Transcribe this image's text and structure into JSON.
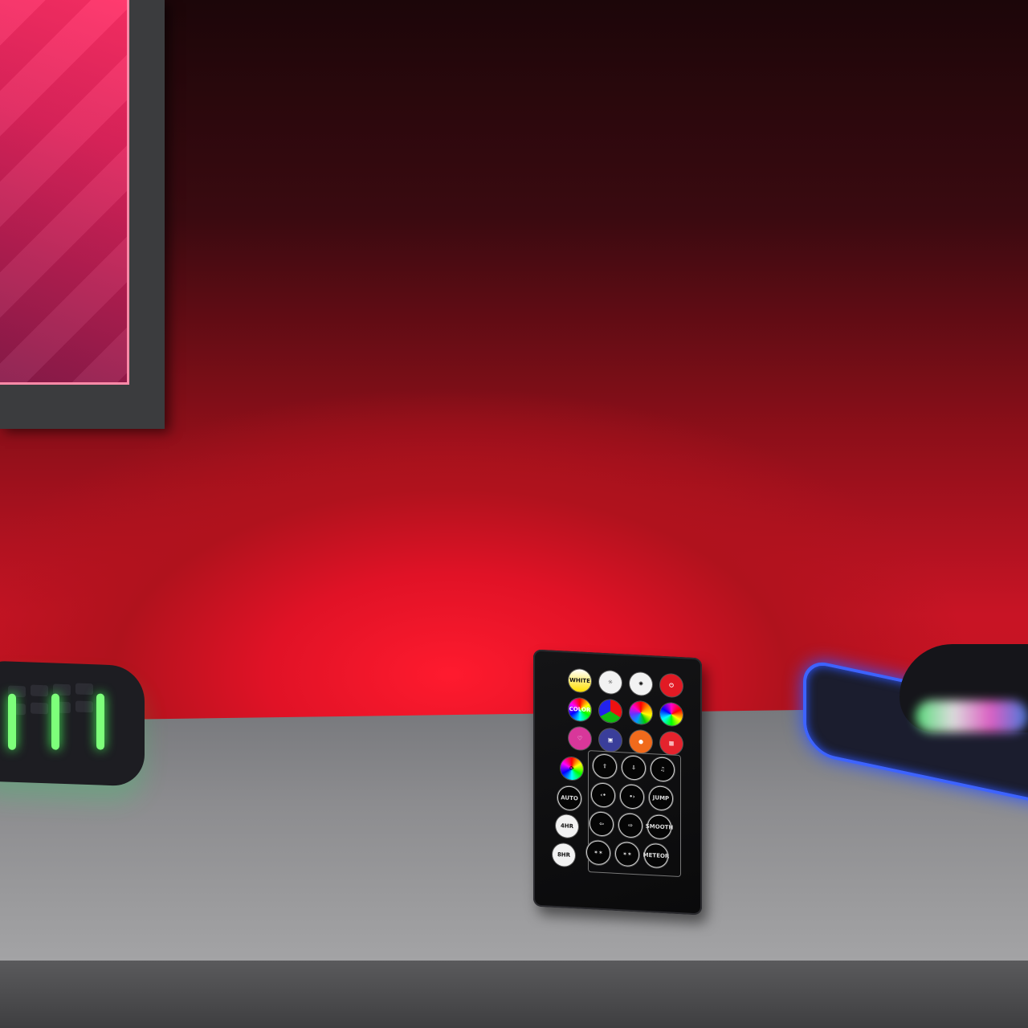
{
  "scene": {
    "colors": {
      "wall_glow": "#e01226",
      "monitor_frame": "#3b3c3e",
      "desk": "#8c8c8f",
      "remote_body": "#0e0e10",
      "keyboard_glow": "#45ff5a",
      "mousepad_glow": "#2d56ff"
    },
    "remote": {
      "top_rows": [
        [
          "WHITE",
          "sun-down-icon",
          "sun-up-icon",
          "power-icon"
        ],
        [
          "COLOR",
          "color-wheel-icon",
          "color-wheel-icon",
          "color-wheel-icon"
        ],
        [
          "heart-icon",
          "cube-icon",
          "pumpkin-icon",
          "gift-icon"
        ]
      ],
      "left_column": [
        "color-cycle-icon",
        "AUTO",
        "4HR",
        "8HR"
      ],
      "panel_grid": [
        [
          "arrow-up-icon",
          "arrow-down-icon",
          "music-note-icon"
        ],
        [
          "collapse-left-icon",
          "collapse-right-icon",
          "JUMP"
        ],
        [
          "arrow-left-icon",
          "arrow-right-icon",
          "SMOOTH"
        ],
        [
          "sparkle-left-icon",
          "sparkle-right-icon",
          "METEOR"
        ]
      ]
    }
  }
}
